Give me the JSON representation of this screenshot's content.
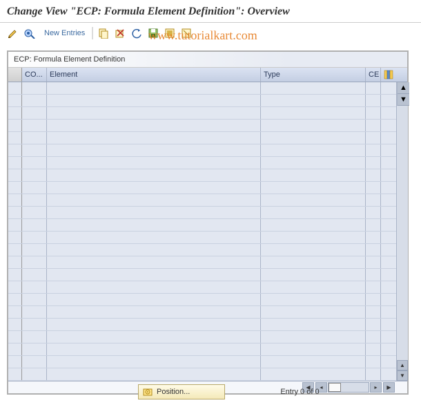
{
  "title": "Change View \"ECP: Formula Element Definition\": Overview",
  "toolbar": {
    "new_entries_label": "New Entries"
  },
  "watermark": "www.tutorialkart.com",
  "grid": {
    "title": "ECP: Formula Element Definition",
    "columns": {
      "co": "CO...",
      "element": "Element",
      "type": "Type",
      "ce": "CE"
    },
    "row_count": 24
  },
  "footer": {
    "position_label": "Position...",
    "entry_status": "Entry 0 of 0"
  },
  "colors": {
    "accent_blue": "#3b6aa0",
    "header_grad_from": "#dbe3f2",
    "header_grad_to": "#c4cfe3",
    "orange_watermark": "#e67e22"
  }
}
